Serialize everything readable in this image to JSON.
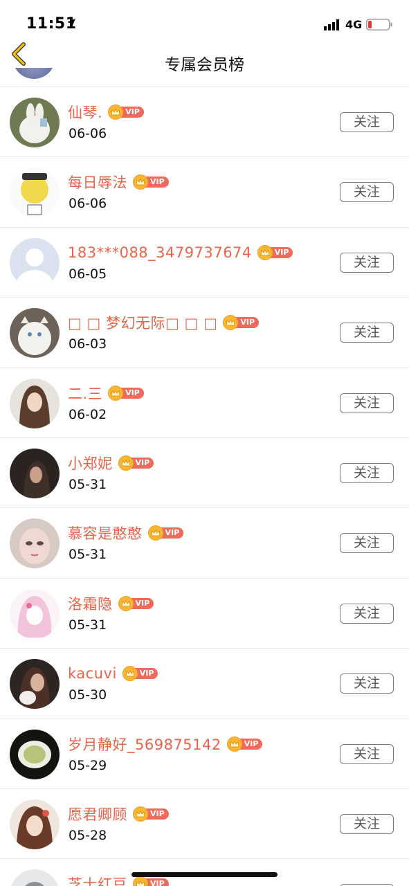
{
  "status_bar": {
    "time": "11:51",
    "network": "4G"
  },
  "nav": {
    "title": "专属会员榜"
  },
  "vip_label": "VIP",
  "follow_label": "关注",
  "members": [
    {
      "name": "仙琴.",
      "date": "06-06"
    },
    {
      "name": "每日辱法",
      "date": "06-06"
    },
    {
      "name": "183***088_3479737674",
      "date": "06-05"
    },
    {
      "name": "□ □ 梦幻无际□ □ □",
      "date": "06-03"
    },
    {
      "name": "二.三",
      "date": "06-02"
    },
    {
      "name": "小郑妮",
      "date": "05-31"
    },
    {
      "name": "慕容是憨憨",
      "date": "05-31"
    },
    {
      "name": "洛霜隐",
      "date": "05-31"
    },
    {
      "name": "kacuvi",
      "date": "05-30"
    },
    {
      "name": "岁月静好_569875142",
      "date": "05-29"
    },
    {
      "name": "愿君卿顾",
      "date": "05-28"
    },
    {
      "name": "芝士红豆",
      "date": ""
    }
  ],
  "colors": {
    "name": "#e8644a",
    "vip_badge": "#ef6a5a",
    "crown": "#f7b733",
    "back_arrow": "#f1c40f"
  }
}
